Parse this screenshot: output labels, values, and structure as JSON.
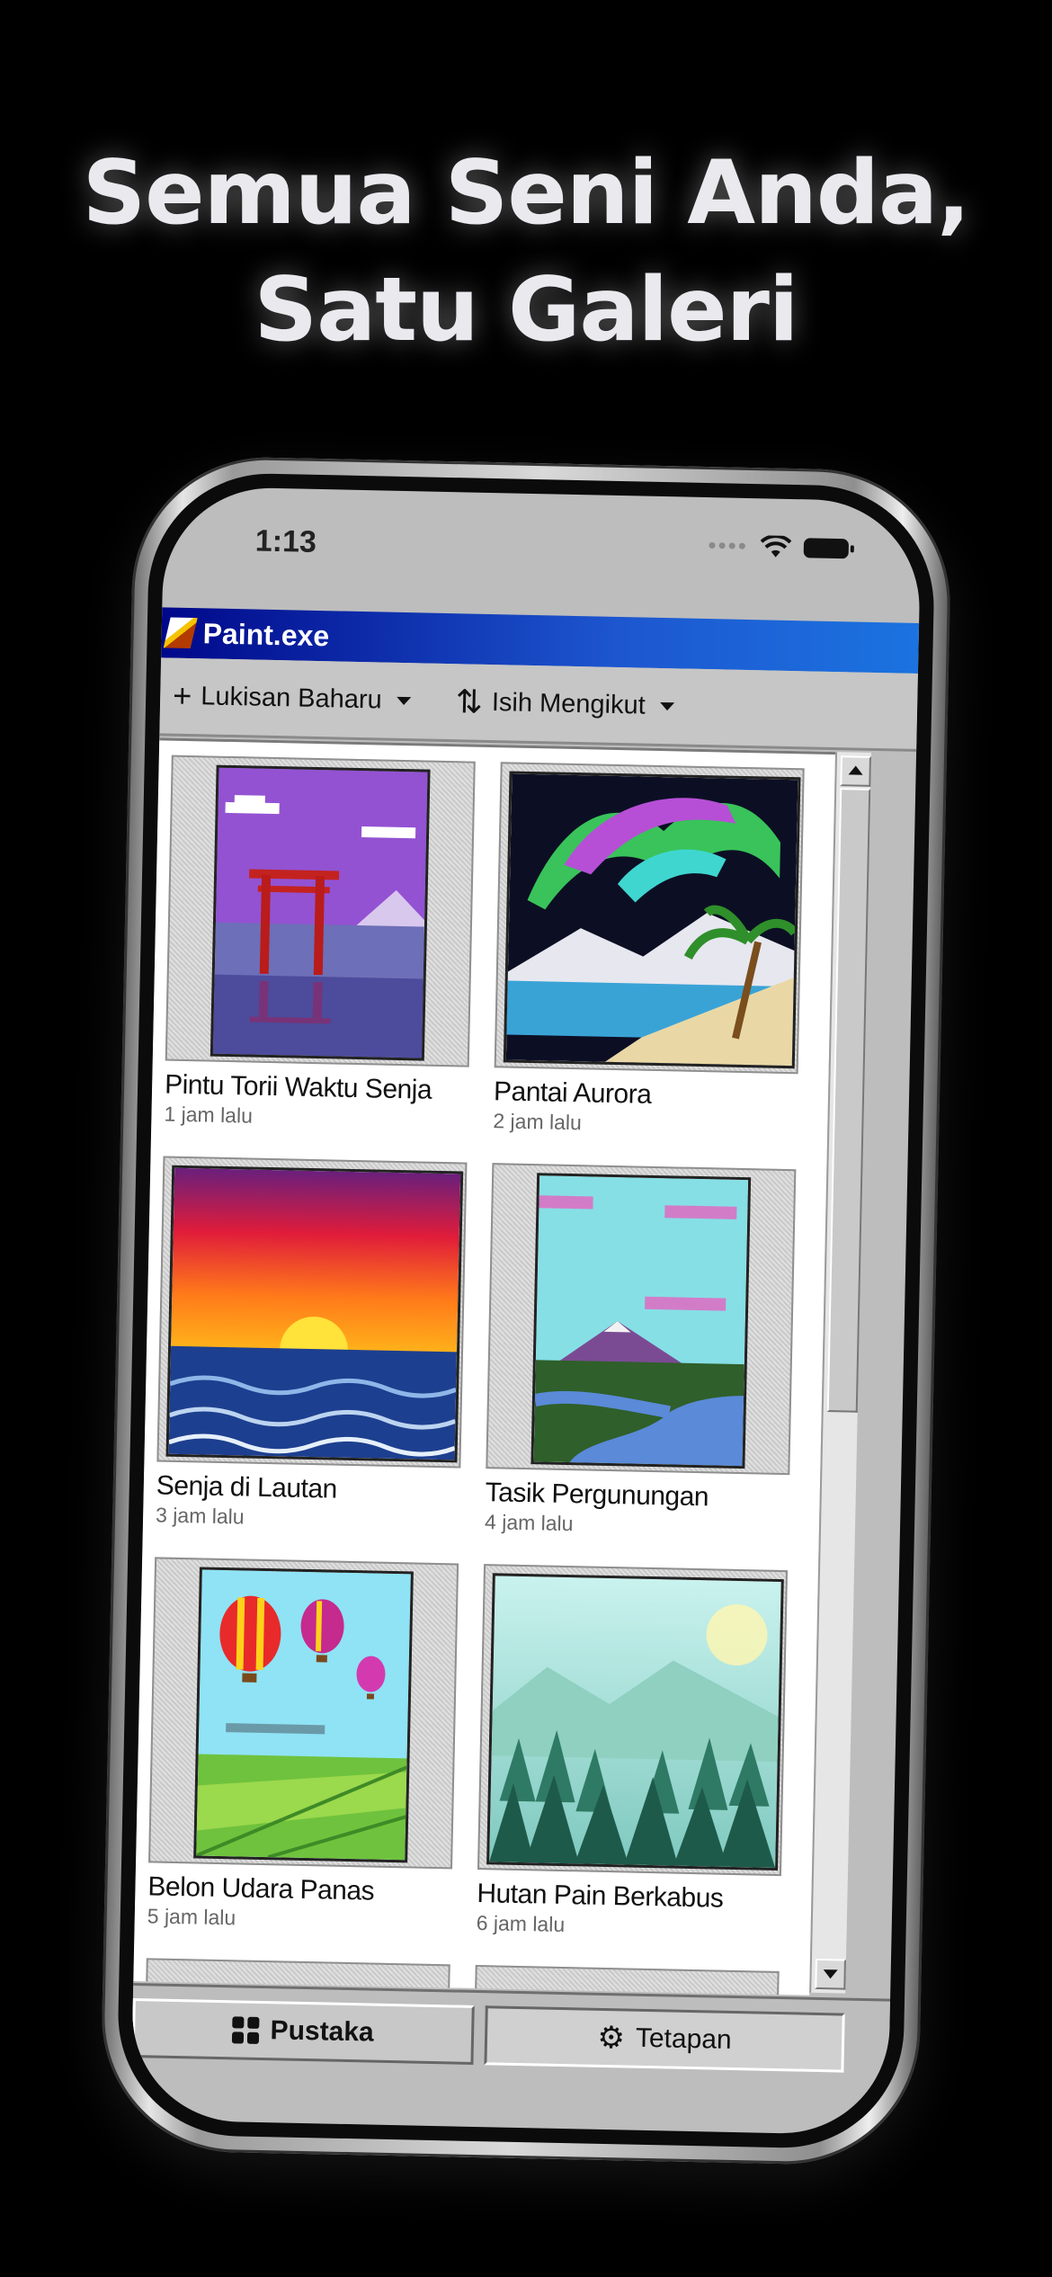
{
  "headline": {
    "line1": "Semua Seni Anda,",
    "line2": "Satu Galeri"
  },
  "status": {
    "time": "1:13"
  },
  "window": {
    "title": "Paint.exe"
  },
  "toolbar": {
    "new_label": "Lukisan Baharu",
    "sort_label": "Isih Mengikut"
  },
  "gallery": {
    "items": [
      {
        "name": "Pintu Torii Waktu Senja",
        "time": "1 jam lalu"
      },
      {
        "name": "Pantai Aurora",
        "time": "2 jam lalu"
      },
      {
        "name": "Senja di Lautan",
        "time": "3 jam lalu"
      },
      {
        "name": "Tasik Pergunungan",
        "time": "4 jam lalu"
      },
      {
        "name": "Belon Udara Panas",
        "time": "5 jam lalu"
      },
      {
        "name": "Hutan Pain Berkabus",
        "time": "6 jam lalu"
      }
    ]
  },
  "tabs": {
    "library": "Pustaka",
    "settings": "Tetapan"
  },
  "colors": {
    "titlebar": "#0a2ca8",
    "background": "#000000",
    "window_gray": "#c6c6c6"
  }
}
